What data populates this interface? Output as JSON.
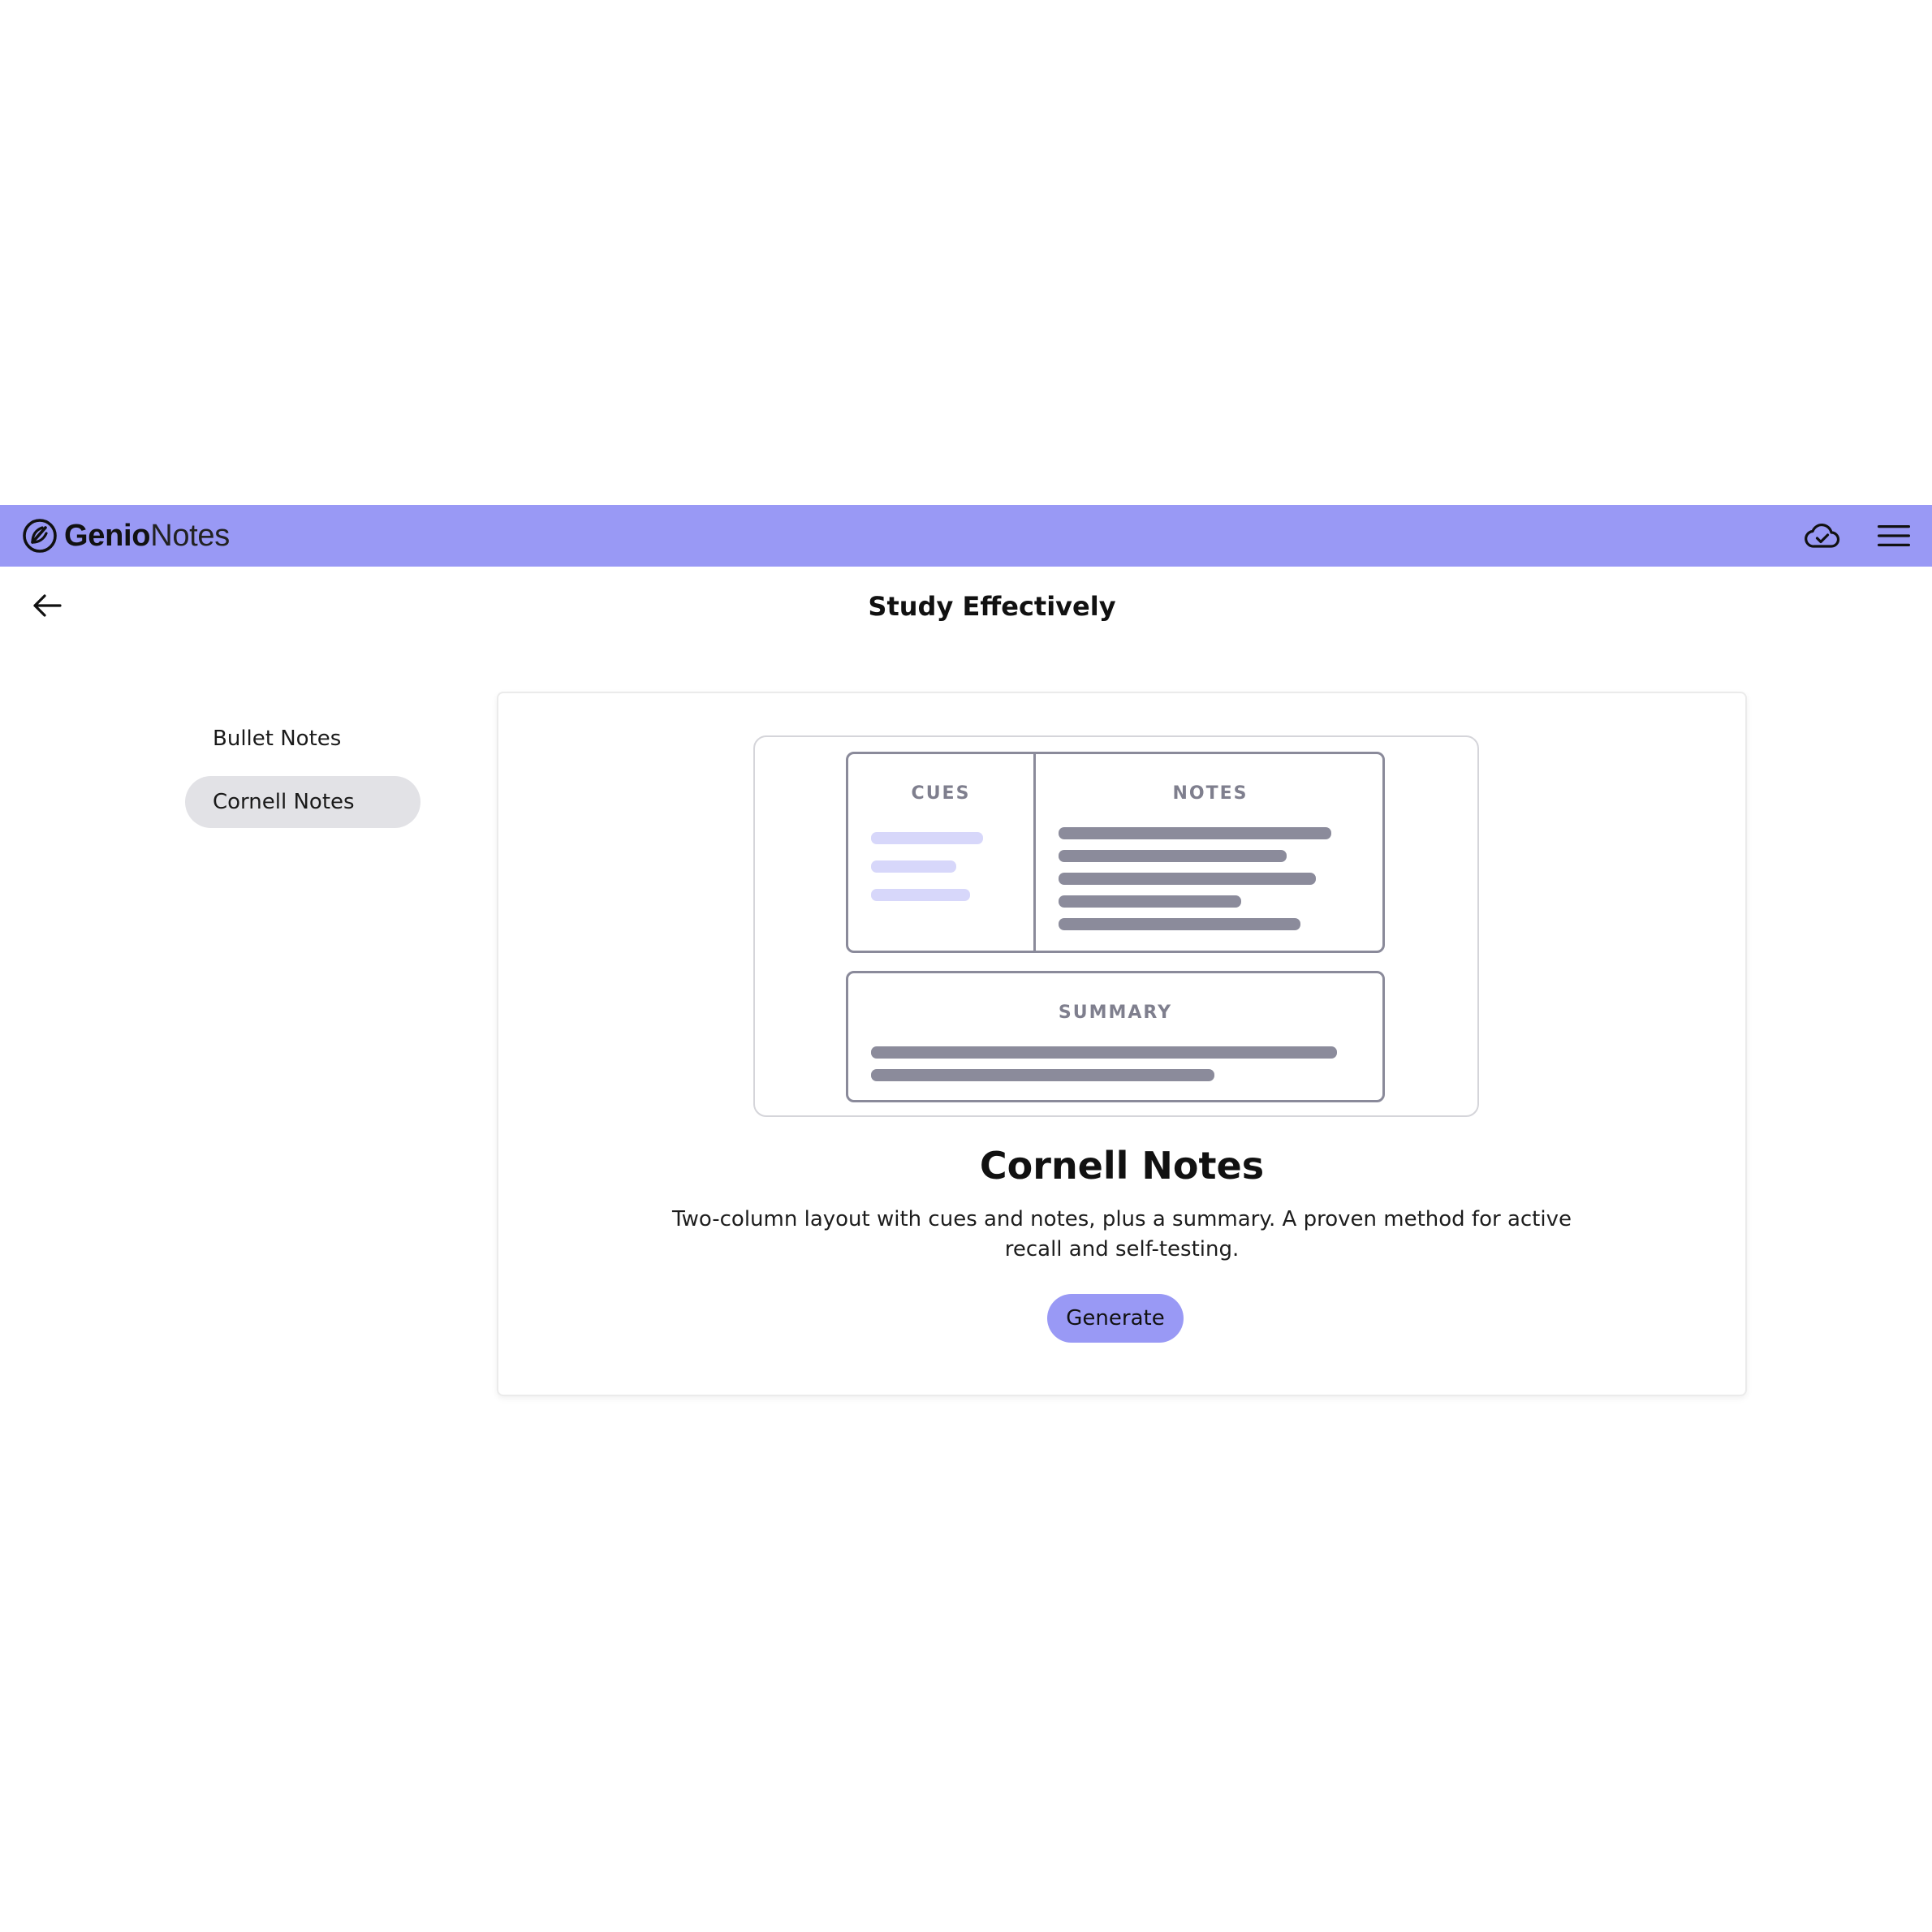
{
  "header": {
    "brand_primary": "Genio",
    "brand_secondary": "Notes",
    "logo_icon": "genio-logo-icon",
    "sync_icon": "cloud-check-icon",
    "menu_icon": "hamburger-menu-icon",
    "background_color": "#9999f5"
  },
  "page": {
    "back_icon": "arrow-left-icon",
    "title": "Study Effectively"
  },
  "sidebar": {
    "items": [
      {
        "label": "Bullet Notes",
        "active": false
      },
      {
        "label": "Cornell Notes",
        "active": true
      }
    ]
  },
  "preview": {
    "cues_label": "CUES",
    "notes_label": "NOTES",
    "summary_label": "SUMMARY"
  },
  "method": {
    "title": "Cornell Notes",
    "description": "Two-column layout with cues and notes, plus a summary. A proven method for active recall and self-testing.",
    "action_label": "Generate",
    "accent_color": "#9999f5"
  }
}
